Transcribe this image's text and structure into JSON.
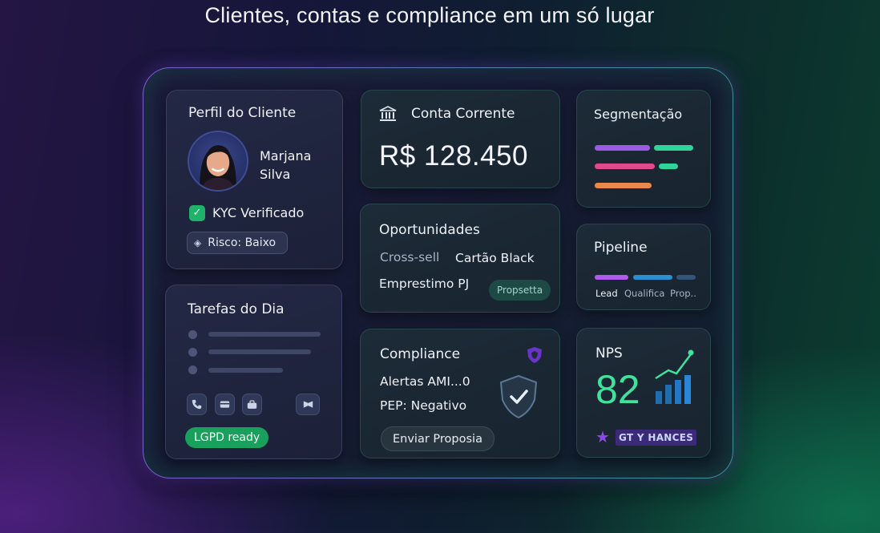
{
  "headline": "Clientes, contas e compliance em um só lugar",
  "perfil": {
    "title": "Perfil do Cliente",
    "name_line1": "Marjana",
    "name_line2": "Silva",
    "kyc_label": "KYC Verificado",
    "risk_label": "Risco: Baixo"
  },
  "tarefas": {
    "title": "Tarefas do Dia",
    "tools": [
      "phone-icon",
      "card-icon",
      "briefcase-icon",
      "flag-icon"
    ],
    "lgpd_label": "LGPD ready"
  },
  "conta": {
    "title": "Conta Corrente",
    "amount": "R$ 128.450"
  },
  "oportunidades": {
    "title": "Oportunidades",
    "item1_label": "Cross-sell",
    "item1_value": "Cartão Black",
    "item2_label": "Emprestimo PJ",
    "item2_badge": "Propsetta"
  },
  "compliance": {
    "title": "Compliance",
    "alerts": "Alertas AMI...0",
    "pep": "PEP: Negativo",
    "send_label": "Enviar Proposia"
  },
  "segmentacao": {
    "title": "Segmentação",
    "colors": [
      "#9b5be6",
      "#2fd49a",
      "#e04a8c",
      "#2fd49a",
      "#e8884a"
    ]
  },
  "pipeline": {
    "title": "Pipeline",
    "stages": [
      "Lead",
      "Qualifica",
      "Prop.."
    ],
    "colors": [
      "#b05af0",
      "#2a8fd0",
      "#33557a"
    ]
  },
  "nps": {
    "title": "NPS",
    "value": "82",
    "badge": "GT Y HANCES",
    "accent": "#3fe39b"
  }
}
